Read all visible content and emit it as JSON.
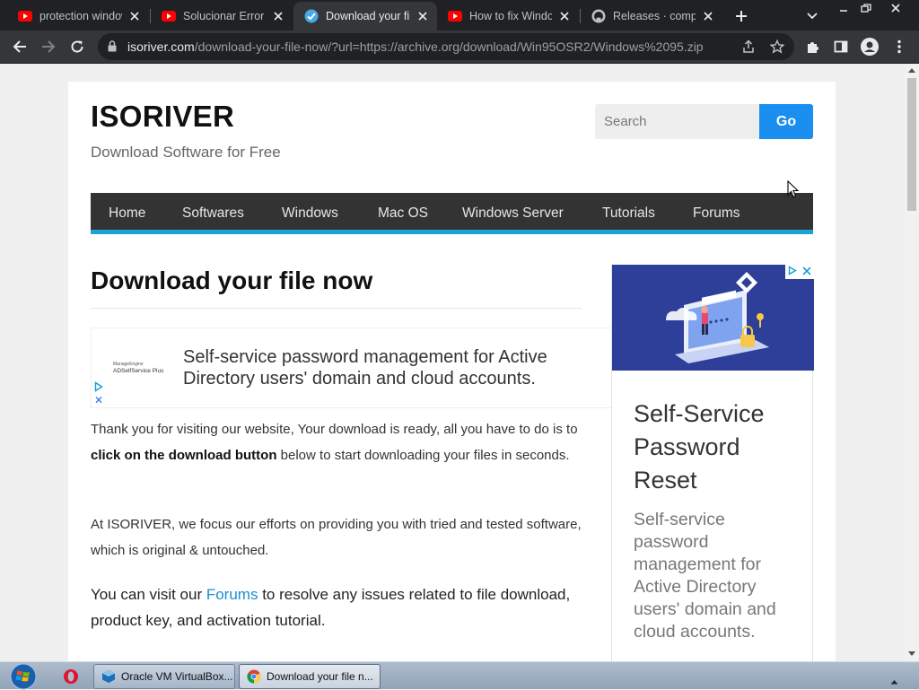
{
  "browser": {
    "tabs": [
      {
        "title": "protection window",
        "favicon": "youtube-icon",
        "active": false
      },
      {
        "title": "Solucionar Error d",
        "favicon": "youtube-icon",
        "active": false
      },
      {
        "title": "Download your fil",
        "favicon": "isoriver-icon",
        "active": true
      },
      {
        "title": "How to fix Windo",
        "favicon": "youtube-icon",
        "active": false
      },
      {
        "title": "Releases · comput",
        "favicon": "github-icon",
        "active": false
      }
    ],
    "url_host": "isoriver.com",
    "url_path": "/download-your-file-now/?url=https://archive.org/download/Win95OSR2/Windows%2095.zip"
  },
  "site": {
    "title": "ISORIVER",
    "tagline": "Download Software for Free",
    "search_placeholder": "Search",
    "search_button": "Go",
    "nav": [
      "Home",
      "Softwares",
      "Windows",
      "Mac OS",
      "Windows Server",
      "Tutorials",
      "Forums"
    ]
  },
  "article": {
    "title": "Download your file now",
    "ad_banner": {
      "logo_top": "ManageEngine",
      "logo": "ADSelfService Plus",
      "text": "Self-service password management for Active Directory users' domain and cloud accounts."
    },
    "para1_a": "Thank you for visiting our website, Your download is ready, all you have to do is to ",
    "para1_bold": "click on the download button",
    "para1_b": " below to start downloading your files in seconds.",
    "para2": "At ISORIVER, we focus our efforts on providing you with tried and tested software, which is original & untouched.",
    "para3_a": "You can visit our ",
    "para3_link": "Forums",
    "para3_b": " to resolve any issues related to file download, product key, and activation tutorial."
  },
  "side_ad": {
    "headline": "Self-Service Password Reset",
    "body": "Self-service password management for Active Directory users' domain and cloud accounts."
  },
  "taskbar": {
    "items": [
      {
        "label": "Oracle VM VirtualBox...",
        "active": false
      },
      {
        "label": "Download your file n...",
        "active": true
      }
    ]
  },
  "colors": {
    "accent": "#1a8ff0",
    "nav_bg": "#333333",
    "nav_underline": "#1ba3d5",
    "link": "#1a8fcf"
  }
}
